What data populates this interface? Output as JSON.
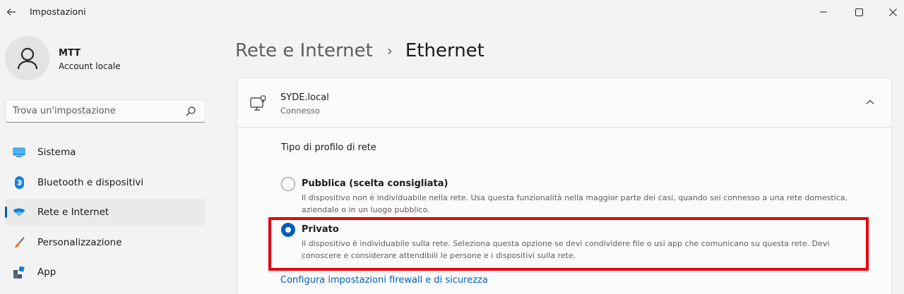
{
  "window": {
    "title": "Impostazioni",
    "back_icon": "back-arrow-icon",
    "controls": [
      "minimize-icon",
      "maximize-icon",
      "close-icon"
    ]
  },
  "profile": {
    "name": "MTT",
    "account_type": "Account locale"
  },
  "search": {
    "placeholder": "Trova un'impostazione",
    "value": ""
  },
  "sidebar": {
    "items": [
      {
        "label": "Sistema",
        "icon": "monitor-icon",
        "active": false
      },
      {
        "label": "Bluetooth e dispositivi",
        "icon": "bluetooth-icon",
        "active": false
      },
      {
        "label": "Rete e Internet",
        "icon": "wifi-icon",
        "active": true
      },
      {
        "label": "Personalizzazione",
        "icon": "brush-icon",
        "active": false
      },
      {
        "label": "App",
        "icon": "apps-icon",
        "active": false
      }
    ]
  },
  "breadcrumb": {
    "parent": "Rete e Internet",
    "separator": "›",
    "current": "Ethernet"
  },
  "network": {
    "name": "SYDE.local",
    "status": "Connesso"
  },
  "profile_type": {
    "label": "Tipo di profilo di rete",
    "options": [
      {
        "title": "Pubblica (scelta consigliata)",
        "description": "Il dispositivo non è individuabile nella rete. Usa questa funzionalità nella maggior parte dei casi, quando sei connesso a una rete domestica, aziendale o in un luogo pubblico.",
        "selected": false
      },
      {
        "title": "Privato",
        "description": "Il dispositivo è individuabile sulla rete. Seleziona questa opzione se devi condividere file o usi app che comunicano su questa rete. Devi conoscere e considerare attendibili le persone e i dispositivi sulla rete.",
        "selected": true
      }
    ]
  },
  "firewall_link": "Configura impostazioni firewall e di sicurezza",
  "colors": {
    "accent": "#005fb8",
    "highlight_border": "#e8000b",
    "background": "#f3f3f3"
  }
}
